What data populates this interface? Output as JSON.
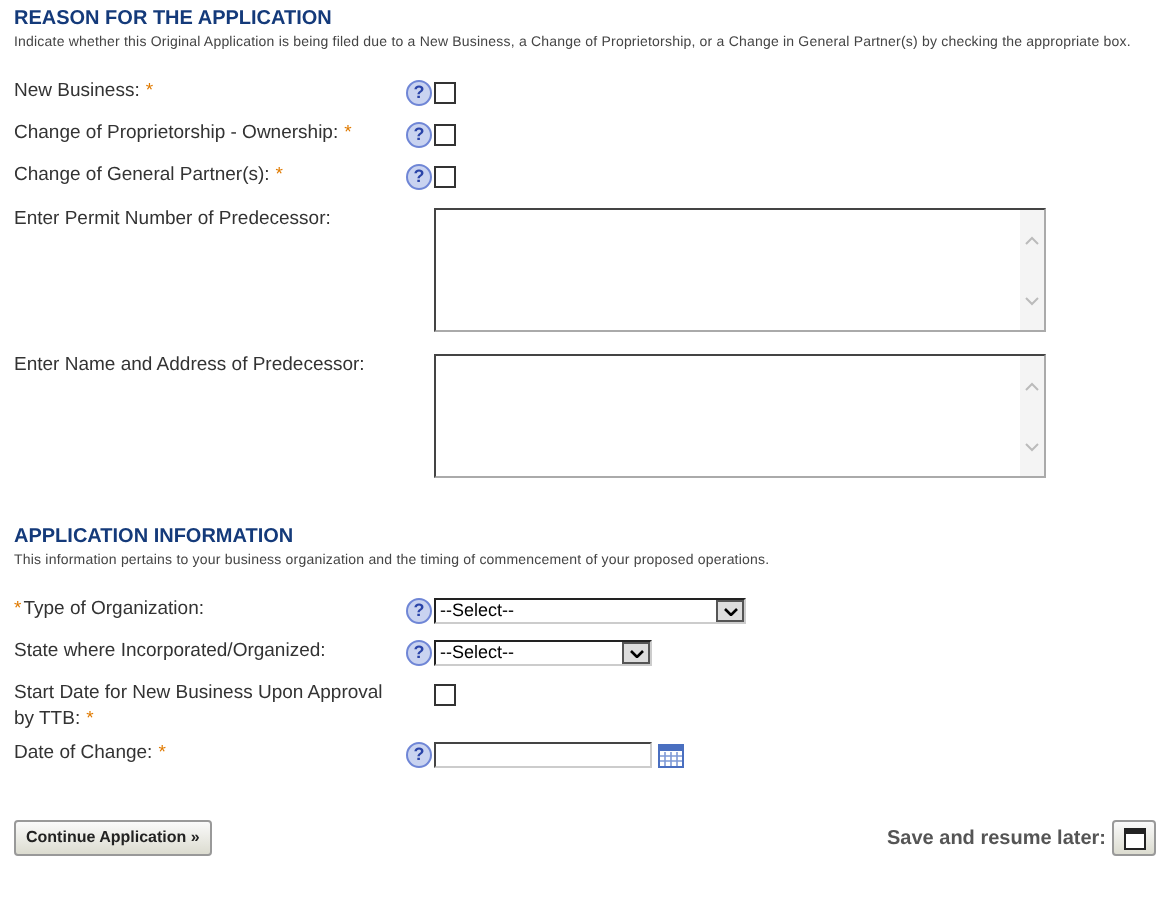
{
  "sections": [
    {
      "title": "REASON FOR THE APPLICATION",
      "description": "Indicate whether this Original Application is being filed due to a New  Business, a Change of Proprietorship, or a Change in General Partner(s) by checking the appropriate box.",
      "fields": [
        {
          "kind": "checkbox",
          "label": "New Business:",
          "required": true,
          "star_before": false,
          "help": true,
          "checked": false
        },
        {
          "kind": "checkbox",
          "label": "Change of Proprietorship - Ownership:",
          "required": true,
          "star_before": false,
          "help": true,
          "checked": false
        },
        {
          "kind": "checkbox",
          "label": "Change of General Partner(s):",
          "required": true,
          "star_before": false,
          "help": true,
          "checked": false
        },
        {
          "kind": "textarea",
          "label": "Enter Permit Number of Predecessor:",
          "required": false,
          "help": false
        },
        {
          "kind": "textarea",
          "label": "Enter Name and Address of Predecessor:",
          "required": false,
          "help": false
        }
      ]
    },
    {
      "title": "APPLICATION INFORMATION",
      "description": "This information pertains to your business organization and the timing of commencement of your proposed operations.",
      "fields": [
        {
          "kind": "select",
          "label": "Type of Organization:",
          "required": true,
          "star_before": true,
          "help": true,
          "value": "--Select--",
          "wide": true
        },
        {
          "kind": "select",
          "label": "State where Incorporated/Organized:",
          "required": false,
          "help": true,
          "value": "--Select--",
          "wide": false
        },
        {
          "kind": "checkbox",
          "label": "Start Date for New Business Upon Approval by TTB:",
          "required": true,
          "star_before": false,
          "help": false,
          "checked": false
        },
        {
          "kind": "date",
          "label": "Date of Change:",
          "required": true,
          "star_before": false,
          "help": true
        }
      ]
    }
  ],
  "star": "*",
  "help_glyph": "?",
  "continue_button": "Continue Application »",
  "save_label": "Save and resume later:"
}
